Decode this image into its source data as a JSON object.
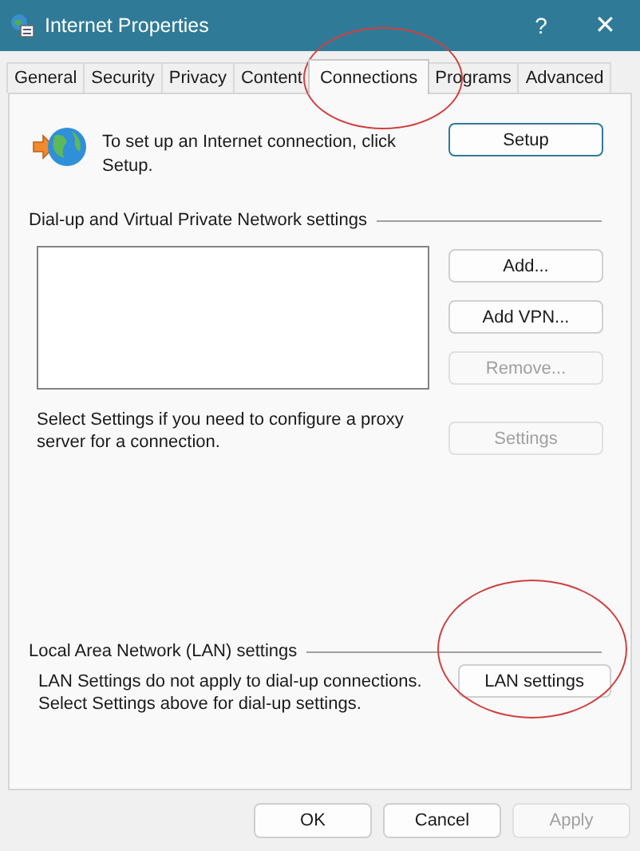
{
  "window": {
    "title": "Internet Properties",
    "help": "?",
    "close": "✕"
  },
  "tabs": [
    {
      "label": "General",
      "selected": false
    },
    {
      "label": "Security",
      "selected": false
    },
    {
      "label": "Privacy",
      "selected": false
    },
    {
      "label": "Content",
      "selected": false
    },
    {
      "label": "Connections",
      "selected": true
    },
    {
      "label": "Programs",
      "selected": false
    },
    {
      "label": "Advanced",
      "selected": false
    }
  ],
  "setup": {
    "text": "To set up an Internet connection, click Setup.",
    "button": "Setup"
  },
  "dialup": {
    "heading": "Dial-up and Virtual Private Network settings",
    "buttons": [
      {
        "label": "Add...",
        "disabled": false
      },
      {
        "label": "Add VPN...",
        "disabled": false
      },
      {
        "label": "Remove...",
        "disabled": true
      },
      {
        "label": "Settings",
        "disabled": true
      }
    ],
    "note": "Select Settings if you need to configure a proxy server for a connection."
  },
  "lan": {
    "heading": "Local Area Network (LAN) settings",
    "text": "LAN Settings do not apply to dial-up connections. Select Settings above for dial-up settings.",
    "button": "LAN settings"
  },
  "footer": [
    {
      "label": "OK",
      "disabled": false
    },
    {
      "label": "Cancel",
      "disabled": false
    },
    {
      "label": "Apply",
      "disabled": true
    }
  ]
}
